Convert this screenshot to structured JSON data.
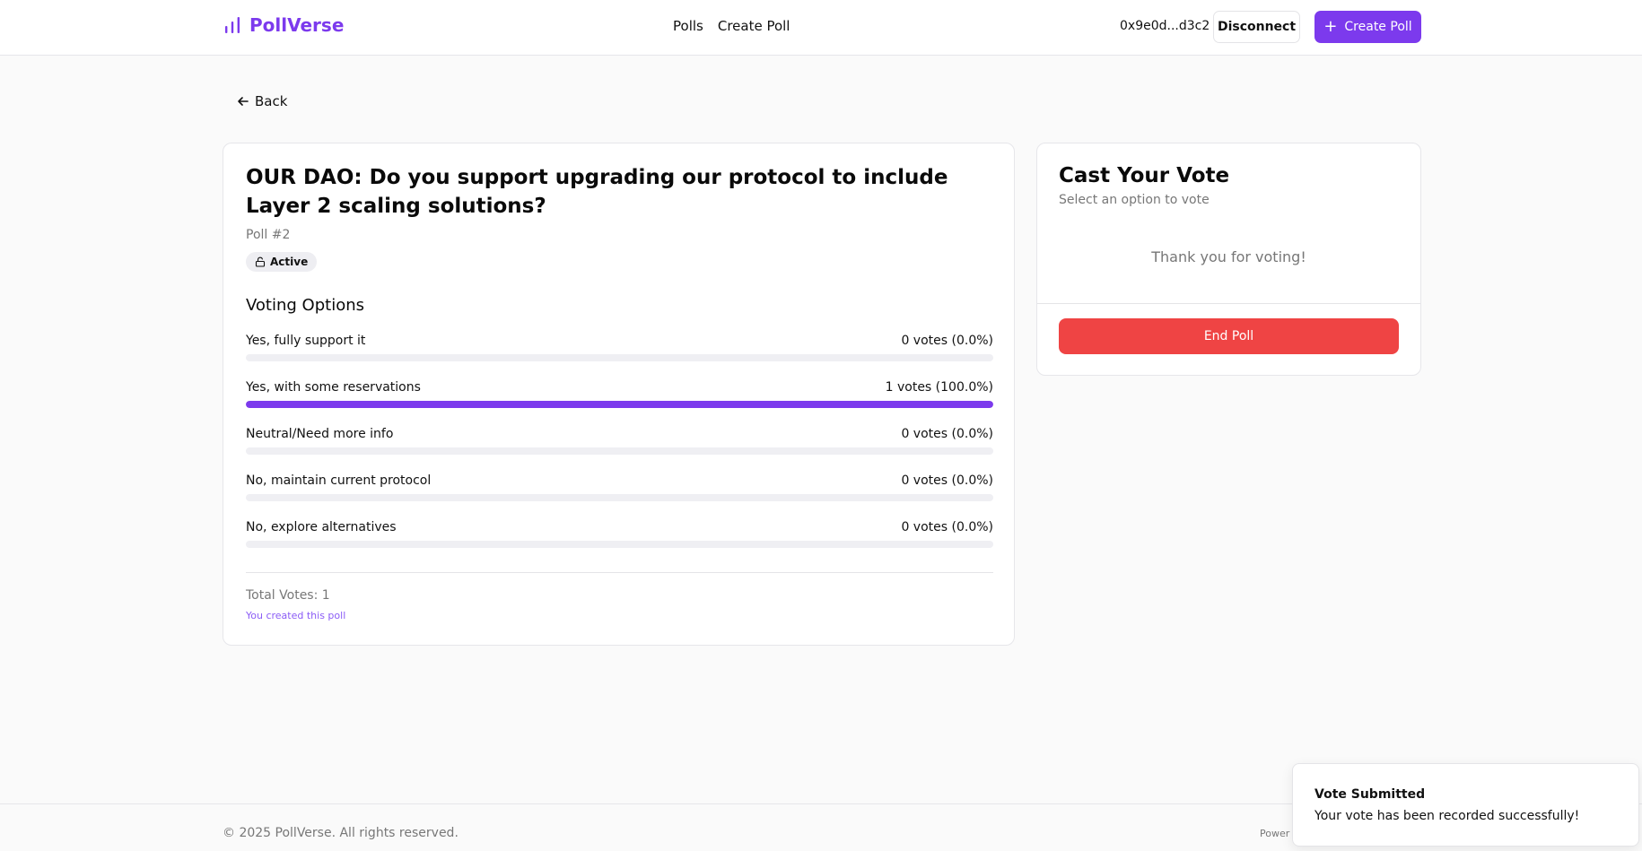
{
  "app": {
    "name": "PollVerse",
    "accent_color": "#7c3aed",
    "brand_icon": "bar-chart-icon"
  },
  "nav": {
    "items": [
      {
        "label": "Polls"
      },
      {
        "label": "Create Poll"
      }
    ]
  },
  "header": {
    "wallet_address": "0x9e0d...d3c2",
    "disconnect_label": "Disconnect",
    "create_poll_label": "Create Poll"
  },
  "back": {
    "label": "Back",
    "icon": "arrow-left-icon"
  },
  "poll": {
    "title": "OUR DAO: Do you support upgrading our protocol to include Layer 2 scaling solutions?",
    "id_label": "Poll #2",
    "status": "Active",
    "status_icon": "unlock-icon",
    "options_heading": "Voting Options",
    "options": [
      {
        "label": "Yes, fully support it",
        "votes_text": "0 votes (0.0%)",
        "percent": 0
      },
      {
        "label": "Yes, with some reservations",
        "votes_text": "1 votes (100.0%)",
        "percent": 100
      },
      {
        "label": "Neutral/Need more info",
        "votes_text": "0 votes (0.0%)",
        "percent": 0
      },
      {
        "label": "No, maintain current protocol",
        "votes_text": "0 votes (0.0%)",
        "percent": 0
      },
      {
        "label": "No, explore alternatives",
        "votes_text": "0 votes (0.0%)",
        "percent": 0
      }
    ],
    "total_votes": "Total Votes: 1",
    "creator_note": "You created this poll"
  },
  "vote_panel": {
    "title": "Cast Your Vote",
    "subtitle": "Select an option to vote",
    "thanks": "Thank you for voting!",
    "end_poll_label": "End Poll",
    "end_poll_color": "#ef4444"
  },
  "footer": {
    "copyright": "© 2025 PollVerse. All rights reserved.",
    "powered": "Power"
  },
  "toast": {
    "title": "Vote Submitted",
    "message": "Your vote has been recorded successfully!"
  }
}
